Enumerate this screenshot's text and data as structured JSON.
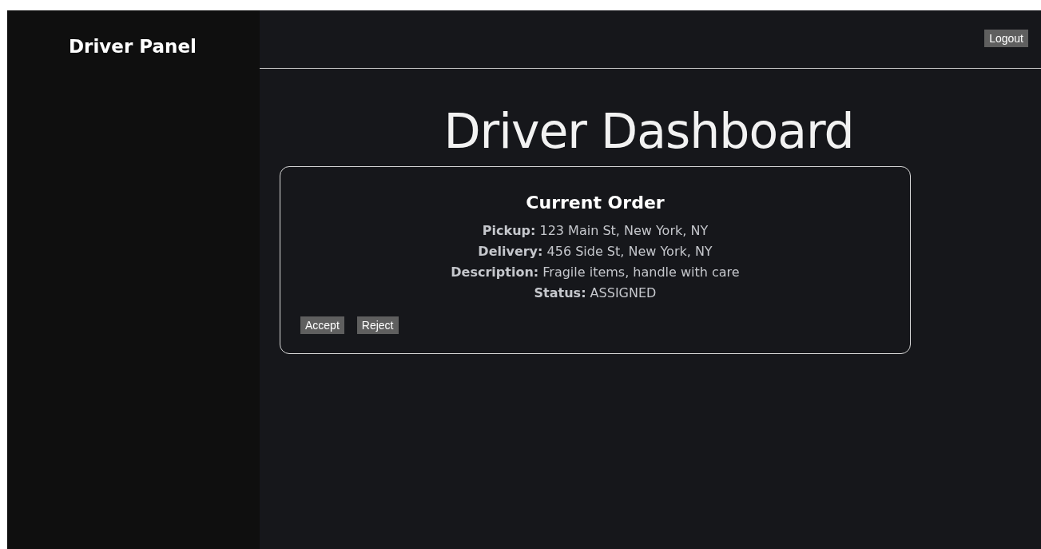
{
  "sidebar": {
    "title": "Driver Panel"
  },
  "header": {
    "logout": "Logout"
  },
  "page_title": "Driver Dashboard",
  "order": {
    "heading": "Current Order",
    "fields": [
      {
        "label": "Pickup:",
        "value": "123 Main St, New York, NY"
      },
      {
        "label": "Delivery:",
        "value": "456 Side St, New York, NY"
      },
      {
        "label": "Description:",
        "value": "Fragile items, handle with care"
      },
      {
        "label": "Status:",
        "value": "ASSIGNED"
      }
    ],
    "buttons": [
      "Accept",
      "Reject"
    ]
  }
}
